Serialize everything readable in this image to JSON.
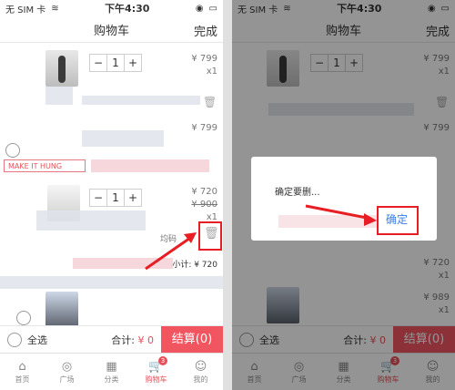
{
  "status_bar": {
    "carrier": "无 SIM 卡",
    "time": "下午4:30"
  },
  "nav": {
    "title": "购物车",
    "done": "完成"
  },
  "items": [
    {
      "qty": "1",
      "price": "¥ 799",
      "count": "x1"
    },
    {
      "price": "¥ 799"
    },
    {
      "qty": "1",
      "price": "¥ 720",
      "old_price": "¥ 900",
      "count": "x1",
      "spec": "均码",
      "subtotal": "小计: ¥ 720"
    }
  ],
  "banner": {
    "text": "MAKE IT HUNG"
  },
  "bottom": {
    "select_all": "全选",
    "total_label": "合计: ",
    "total_value": "¥ 0",
    "checkout": "结算(0)"
  },
  "tabs": [
    {
      "label": "首页",
      "icon": "home-icon"
    },
    {
      "label": "广场",
      "icon": "compass-icon"
    },
    {
      "label": "分类",
      "icon": "grid-icon"
    },
    {
      "label": "购物车",
      "icon": "cart-icon",
      "badge": "3"
    },
    {
      "label": "我的",
      "icon": "person-icon"
    }
  ],
  "right": {
    "items": [
      {
        "qty": "1",
        "price": "¥ 799",
        "count": "x1"
      },
      {
        "price": "¥ 799"
      },
      {
        "price": "¥ 720",
        "count": "x1"
      },
      {
        "price": "¥ 989",
        "count": "x1"
      }
    ],
    "dialog": {
      "message": "确定要删...",
      "confirm": "确定"
    }
  },
  "colors": {
    "accent": "#f1555f",
    "highlight": "#e81e25",
    "link": "#3a7ee8"
  }
}
